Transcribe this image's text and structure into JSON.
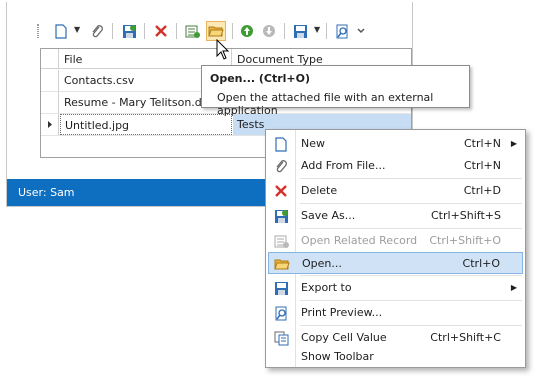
{
  "grid": {
    "columns": [
      "File",
      "Document Type"
    ],
    "rows": [
      {
        "file": "Contacts.csv",
        "type": ""
      },
      {
        "file": "Resume - Mary Telitson.docx",
        "type": ""
      },
      {
        "file": "Untitled.jpg",
        "type": "Tests"
      }
    ]
  },
  "status": {
    "user": "User: Sam"
  },
  "tooltip": {
    "title": "Open... (Ctrl+O)",
    "body": "Open the attached file with an external application"
  },
  "menu": {
    "items": [
      {
        "label": "New",
        "shortcut": "Ctrl+N",
        "icon": "new-document-icon"
      },
      {
        "label": "Add From File...",
        "shortcut": "Ctrl+N",
        "icon": "paperclip-icon"
      },
      {
        "label": "Delete",
        "shortcut": "Ctrl+D",
        "icon": "delete-x-icon"
      },
      {
        "label": "Save As...",
        "shortcut": "Ctrl+Shift+S",
        "icon": "save-as-icon"
      },
      {
        "label": "Open Related Record",
        "shortcut": "Ctrl+Shift+O",
        "icon": "related-record-icon"
      },
      {
        "label": "Open...",
        "shortcut": "Ctrl+O",
        "icon": "open-folder-icon"
      },
      {
        "label": "Export to",
        "shortcut": "",
        "icon": "export-icon"
      },
      {
        "label": "Print Preview...",
        "shortcut": "",
        "icon": "print-preview-icon"
      },
      {
        "label": "Copy Cell Value",
        "shortcut": "Ctrl+Shift+C",
        "icon": "copy-cell-icon"
      },
      {
        "label": "Show Toolbar",
        "shortcut": "",
        "icon": ""
      }
    ]
  },
  "colors": {
    "statusbar": "#0e6fc1",
    "selection": "#c7ddf4",
    "menu_highlight": "#cfe2f6",
    "toolbar_highlight": "#fbe8b4",
    "delete_red": "#d0332c",
    "green": "#3f9c35"
  }
}
